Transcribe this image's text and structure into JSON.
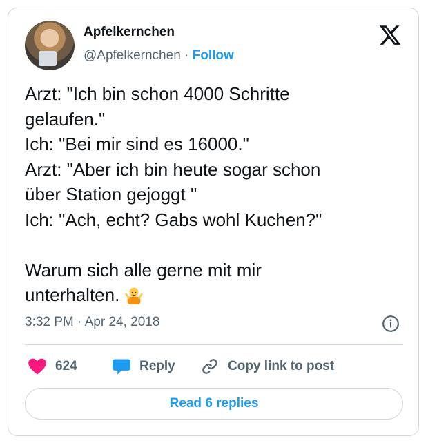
{
  "author": {
    "name": "Apfelkernchen",
    "handle": "@Apfelkernchen",
    "separator": "·",
    "follow_label": "Follow"
  },
  "tweet": {
    "lines": [
      "Arzt: \"Ich bin schon 4000 Schritte",
      "gelaufen.\"",
      "Ich: \"Bei mir sind es 16000.\"",
      "Arzt: \"Aber ich bin heute sogar schon",
      "über Station gejoggt \"",
      "Ich: \"Ach, echt? Gabs wohl Kuchen?\"",
      "",
      "Warum sich alle gerne mit mir",
      "unterhalten."
    ],
    "emoji": "person-shrugging-emoji"
  },
  "meta": {
    "time": "3:32 PM",
    "separator": "·",
    "date": "Apr 24, 2018"
  },
  "actions": {
    "like_count": "624",
    "reply_label": "Reply",
    "copy_label": "Copy link to post"
  },
  "read_replies_label": "Read 6 replies",
  "colors": {
    "accent": "#1d9bf0",
    "like": "#f91880",
    "muted": "#536471",
    "border": "#cfd9de"
  },
  "icons": {
    "logo": "x-logo-icon",
    "info": "info-icon",
    "like": "heart-icon",
    "reply": "speech-bubble-icon",
    "copy": "link-icon"
  }
}
